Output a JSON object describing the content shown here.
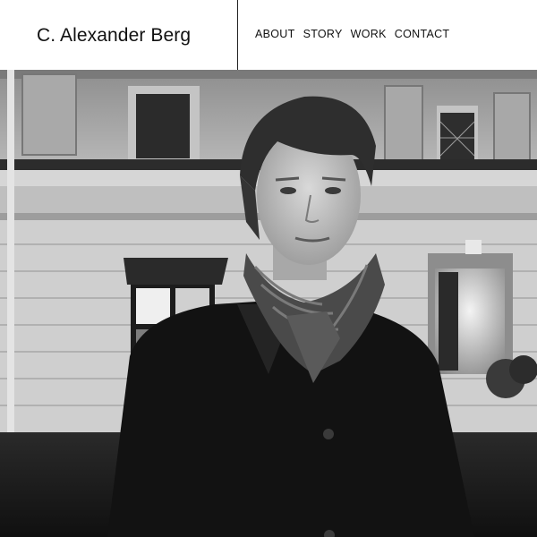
{
  "site": {
    "title": "C. Alexander Berg"
  },
  "nav": {
    "items": [
      {
        "label": "ABOUT"
      },
      {
        "label": "STORY"
      },
      {
        "label": "WORK"
      },
      {
        "label": "CONTACT"
      }
    ]
  }
}
